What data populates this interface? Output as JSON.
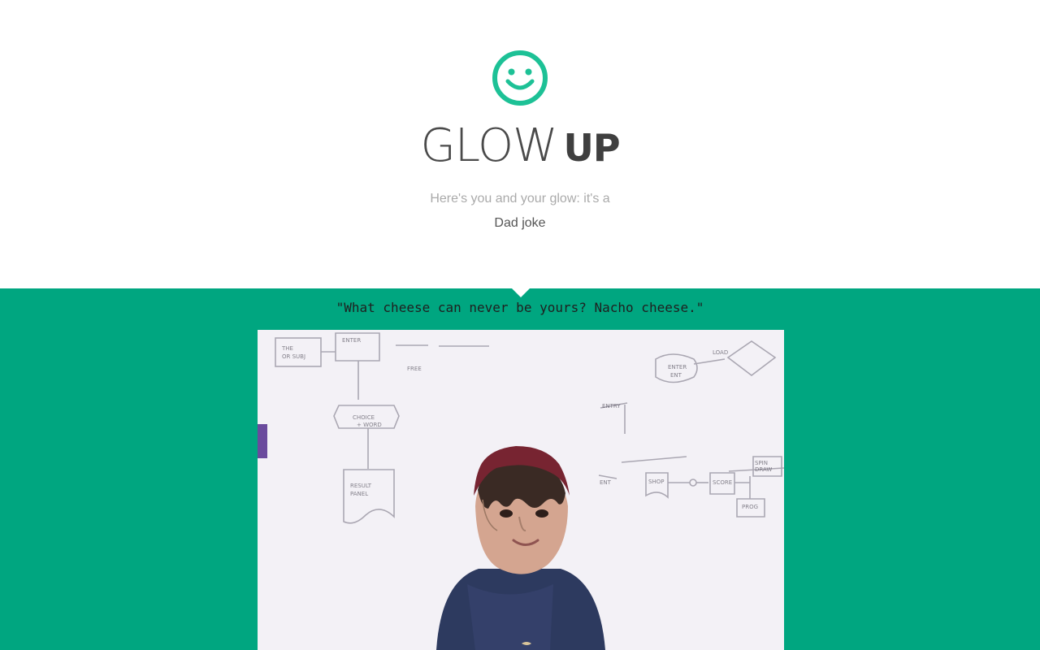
{
  "header": {
    "title_light": "GLOW",
    "title_bold": "UP",
    "subtitle": "Here's you and your glow: it's a",
    "category": "Dad joke",
    "logo_icon": "smiley-face-icon"
  },
  "main": {
    "joke": "\"What cheese can never be yours? Nacho cheese.\""
  },
  "colors": {
    "accent": "#00a680",
    "logo": "#1dc196"
  }
}
